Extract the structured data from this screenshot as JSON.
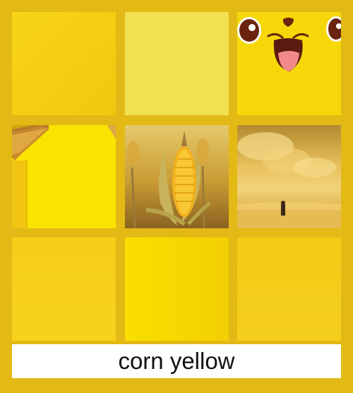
{
  "caption": "corn yellow",
  "tiles": [
    {
      "id": "yellow-swatch-gradient"
    },
    {
      "id": "pale-yellow-swatch"
    },
    {
      "id": "cartoon-face-yellow"
    },
    {
      "id": "yellow-wall-with-roof"
    },
    {
      "id": "corn-cob-photo"
    },
    {
      "id": "golden-sky-with-figure"
    },
    {
      "id": "yellow-swatch-plain"
    },
    {
      "id": "bright-yellow-swatch"
    },
    {
      "id": "yellow-swatch-soft"
    }
  ],
  "colors": {
    "background": "#e3b916",
    "caption_background": "#ffffff",
    "caption_text": "#111111"
  }
}
